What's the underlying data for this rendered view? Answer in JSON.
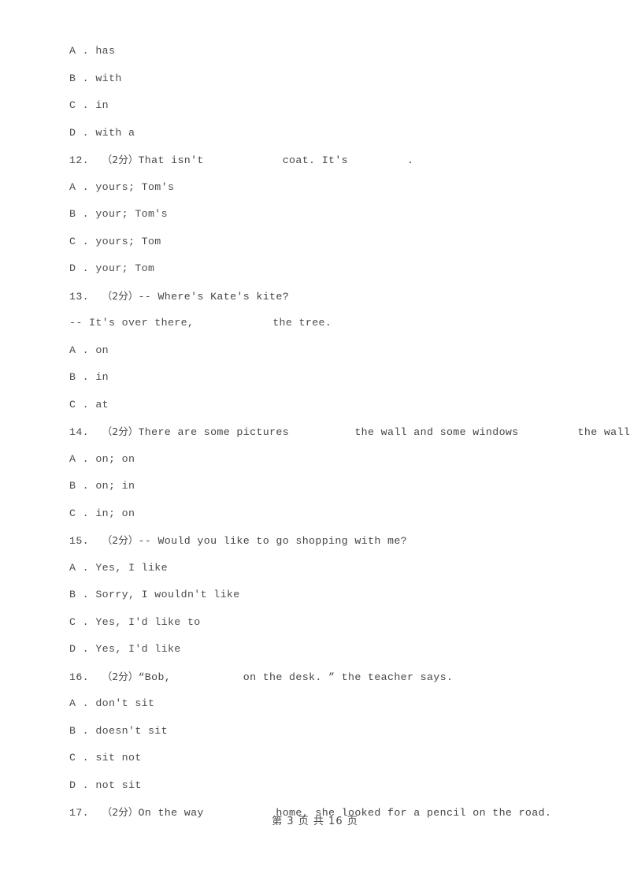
{
  "page": {
    "background_color": "#ffffff",
    "text_color": "#4a4a4a",
    "footer": "第 3 页 共 16 页"
  },
  "lines": [
    {
      "kind": "option",
      "label": "A .",
      "text": "has"
    },
    {
      "kind": "option",
      "label": "B .",
      "text": "with"
    },
    {
      "kind": "option",
      "label": "C .",
      "text": "in"
    },
    {
      "kind": "option",
      "label": "D .",
      "text": "with a"
    },
    {
      "kind": "stem",
      "number": "12.",
      "score": "（2分）",
      "text": "That isn't            coat. It's         ."
    },
    {
      "kind": "option",
      "label": "A .",
      "text": "yours; Tom's"
    },
    {
      "kind": "option",
      "label": "B .",
      "text": "your; Tom's"
    },
    {
      "kind": "option",
      "label": "C .",
      "text": "yours; Tom"
    },
    {
      "kind": "option",
      "label": "D .",
      "text": "your; Tom"
    },
    {
      "kind": "stem",
      "number": "13.",
      "score": "（2分）",
      "text": "-- Where's Kate's kite?"
    },
    {
      "kind": "cont",
      "text": "-- It's over there,            the tree."
    },
    {
      "kind": "option",
      "label": "A .",
      "text": "on"
    },
    {
      "kind": "option",
      "label": "B .",
      "text": "in"
    },
    {
      "kind": "option",
      "label": "C .",
      "text": "at"
    },
    {
      "kind": "stem",
      "number": "14.",
      "score": "（2分）",
      "text": "There are some pictures          the wall and some windows         the wall."
    },
    {
      "kind": "option",
      "label": "A .",
      "text": "on; on"
    },
    {
      "kind": "option",
      "label": "B .",
      "text": "on; in"
    },
    {
      "kind": "option",
      "label": "C .",
      "text": "in; on"
    },
    {
      "kind": "stem",
      "number": "15.",
      "score": "（2分）",
      "text": "-- Would you like to go shopping with me?"
    },
    {
      "kind": "option",
      "label": "A .",
      "text": "Yes, I like"
    },
    {
      "kind": "option",
      "label": "B .",
      "text": "Sorry, I wouldn't like"
    },
    {
      "kind": "option",
      "label": "C .",
      "text": "Yes, I'd like to"
    },
    {
      "kind": "option",
      "label": "D .",
      "text": "Yes, I'd like"
    },
    {
      "kind": "stem",
      "number": "16.",
      "score": "（2分）",
      "text": "“Bob,           on the desk. ” the teacher says."
    },
    {
      "kind": "option",
      "label": "A .",
      "text": "don't sit"
    },
    {
      "kind": "option",
      "label": "B .",
      "text": "doesn't sit"
    },
    {
      "kind": "option",
      "label": "C .",
      "text": "sit not"
    },
    {
      "kind": "option",
      "label": "D .",
      "text": "not sit"
    },
    {
      "kind": "stem",
      "number": "17.",
      "score": "（2分）",
      "text": "On the way           home, she looked for a pencil on the road."
    }
  ]
}
